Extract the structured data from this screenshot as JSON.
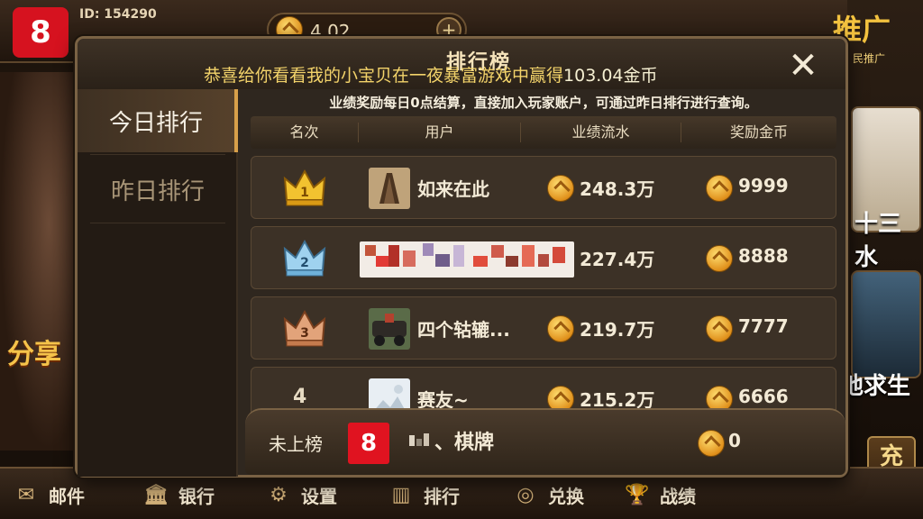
{
  "header": {
    "player_id": "ID: 154290",
    "balance": "4.02",
    "add_symbol": "+"
  },
  "background": {
    "share_label": "分享",
    "promo_label": "推广",
    "promo_sub": "民推广",
    "game1_label": "十三水",
    "game2_label": "地求生",
    "recharge_label": "充值"
  },
  "bottom_nav": [
    {
      "label": "邮件",
      "icon": "mail-icon"
    },
    {
      "label": "银行",
      "icon": "bank-icon"
    },
    {
      "label": "设置",
      "icon": "settings-gear-icon"
    },
    {
      "label": "排行",
      "icon": "ranking-icon"
    },
    {
      "label": "兑换",
      "icon": "exchange-coins-icon"
    },
    {
      "label": "战绩",
      "icon": "trophy-icon"
    }
  ],
  "modal": {
    "title": "排行榜",
    "marquee_prefix": "恭喜给你看看我的小宝贝在一夜暴富游戏中赢得",
    "marquee_amount": "103.04金币",
    "close_symbol": "✕",
    "tabs": [
      "今日排行",
      "昨日排行"
    ],
    "active_tab": 0,
    "notice": "业绩奖励每日0点结算，直接加入玩家账户，可通过昨日排行进行查询。",
    "columns": [
      "名次",
      "用户",
      "业绩流水",
      "奖励金币"
    ],
    "rows": [
      {
        "rank": "1",
        "user": "如来在此",
        "performance": "248.3万",
        "reward": "9999",
        "badge": "gold"
      },
      {
        "rank": "2",
        "user": "",
        "performance": "227.4万",
        "reward": "8888",
        "badge": "silver"
      },
      {
        "rank": "3",
        "user": "四个轱辘...",
        "performance": "219.7万",
        "reward": "7777",
        "badge": "bronze"
      },
      {
        "rank": "4",
        "user": "赛友~",
        "performance": "215.2万",
        "reward": "6666",
        "badge": "plain"
      }
    ],
    "footer": {
      "label": "未上榜",
      "name": "、棋牌",
      "coins": "0"
    }
  },
  "colors": {
    "accent_gold": "#d8a04a",
    "marquee_yellow": "#f3d36a",
    "logo_red": "#d6121f"
  }
}
